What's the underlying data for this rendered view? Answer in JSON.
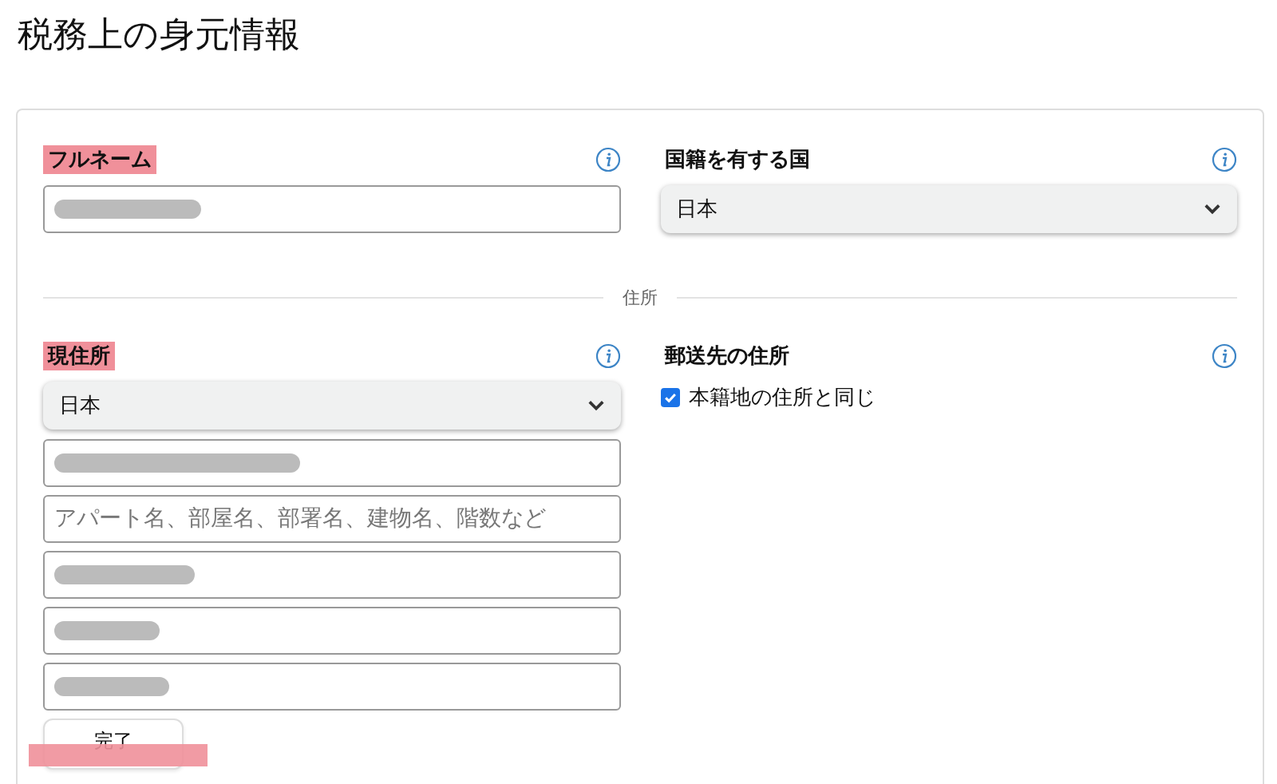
{
  "page_title": "税務上の身元情報",
  "top_row": [
    {
      "label": "フルネーム",
      "highlighted": true,
      "kind": "text",
      "redacted": true
    },
    {
      "label": "国籍を有する国",
      "highlighted": false,
      "kind": "select",
      "value": "日本"
    }
  ],
  "divider_label": "住所",
  "current_address": {
    "label": "現住所",
    "highlighted": true,
    "country": "日本",
    "fields": [
      {
        "redacted": true
      },
      {
        "redacted": false,
        "placeholder": "アパート名、部屋名、部署名、建物名、階数など"
      },
      {
        "redacted": true
      },
      {
        "redacted": true
      },
      {
        "redacted": true
      }
    ]
  },
  "mailing_address": {
    "label": "郵送先の住所",
    "highlighted": false,
    "same_as": {
      "label": "本籍地の住所と同じ",
      "checked": true
    }
  },
  "done_button": {
    "label": "完了",
    "highlighted": true
  }
}
